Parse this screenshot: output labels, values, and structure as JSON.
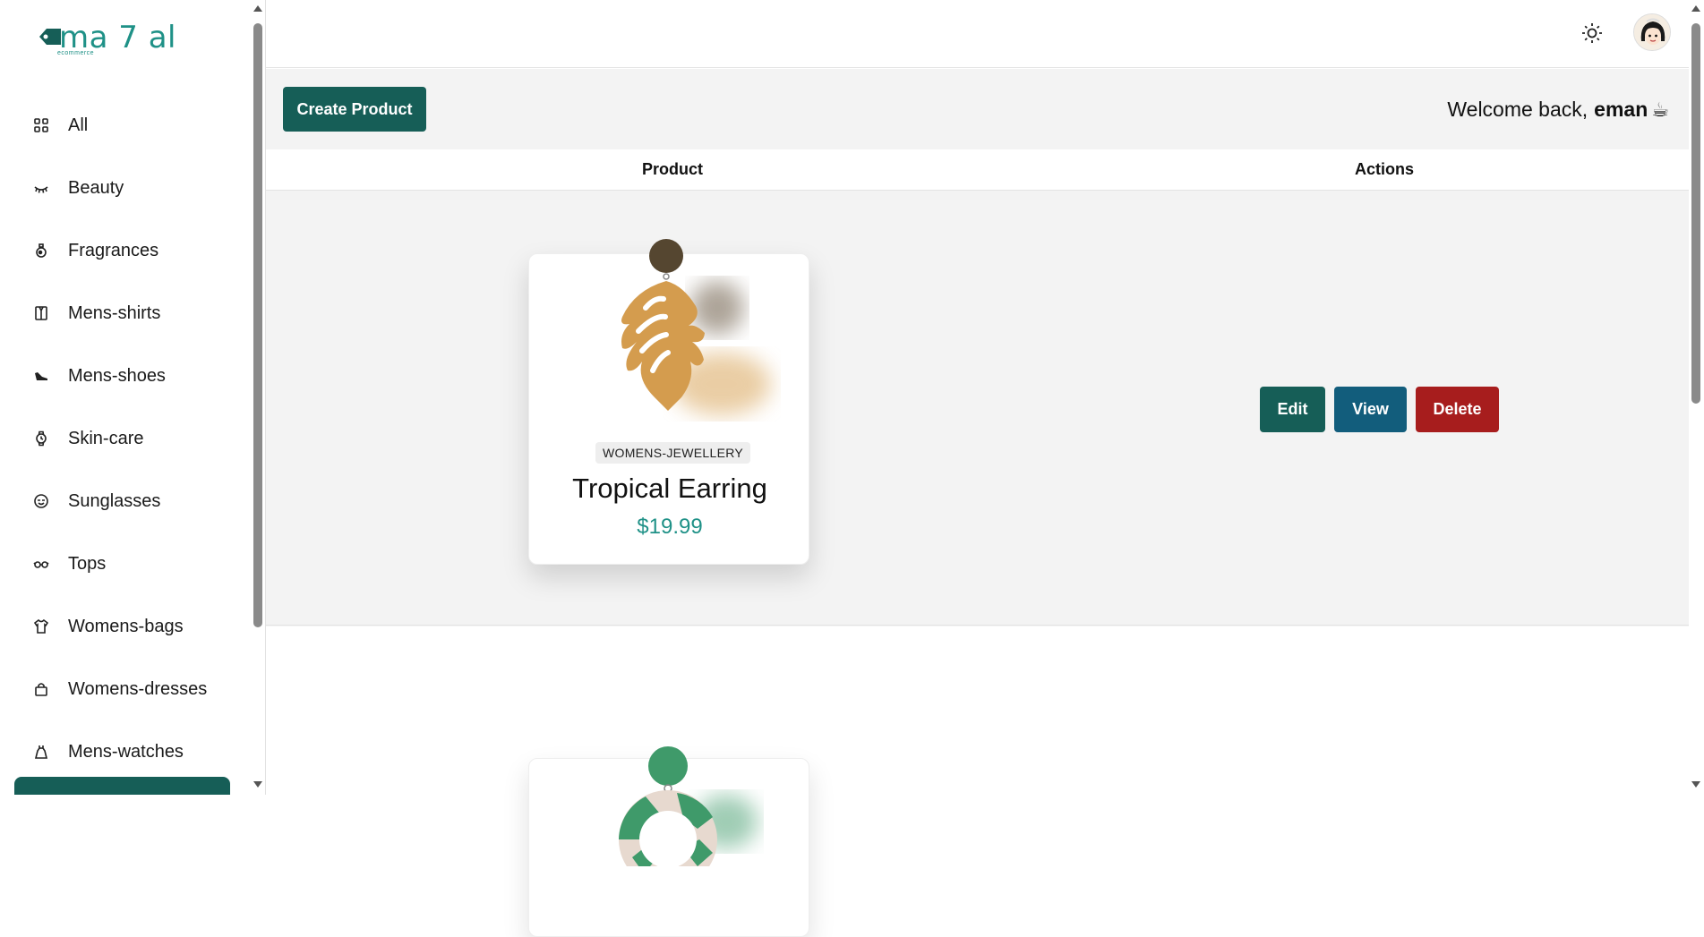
{
  "brand": {
    "name": "ma 7 al",
    "tagline": "ecommerce",
    "color": "#1f9187",
    "logo_icon": "tag-icon"
  },
  "sidebar": {
    "items": [
      {
        "label": "All",
        "icon": "grid-icon"
      },
      {
        "label": "Beauty",
        "icon": "eyelash-icon"
      },
      {
        "label": "Fragrances",
        "icon": "perfume-icon"
      },
      {
        "label": "Mens-shirts",
        "icon": "shirt-icon"
      },
      {
        "label": "Mens-shoes",
        "icon": "shoe-icon"
      },
      {
        "label": "Skin-care",
        "icon": "watch-icon"
      },
      {
        "label": "Sunglasses",
        "icon": "smile-icon"
      },
      {
        "label": "Tops",
        "icon": "glasses-icon"
      },
      {
        "label": "Womens-bags",
        "icon": "tshirt-icon"
      },
      {
        "label": "Womens-dresses",
        "icon": "bag-icon"
      },
      {
        "label": "Mens-watches",
        "icon": "dress-icon"
      }
    ]
  },
  "header": {
    "theme_icon": "sun-icon",
    "avatar": "user-avatar"
  },
  "toolbar": {
    "create_label": "Create Product",
    "welcome_prefix": "Welcome back,",
    "username": "eman",
    "welcome_emoji": "☕"
  },
  "table": {
    "columns": [
      "Product",
      "Actions"
    ],
    "rows": [
      {
        "category": "WOMENS-JEWELLERY",
        "title": "Tropical Earring",
        "price": "$19.99",
        "actions": {
          "edit": "Edit",
          "view": "View",
          "delete": "Delete"
        }
      }
    ]
  },
  "colors": {
    "primary": "#165e57",
    "view": "#125d7c",
    "danger": "#a71d1d",
    "accent": "#1f9187"
  }
}
